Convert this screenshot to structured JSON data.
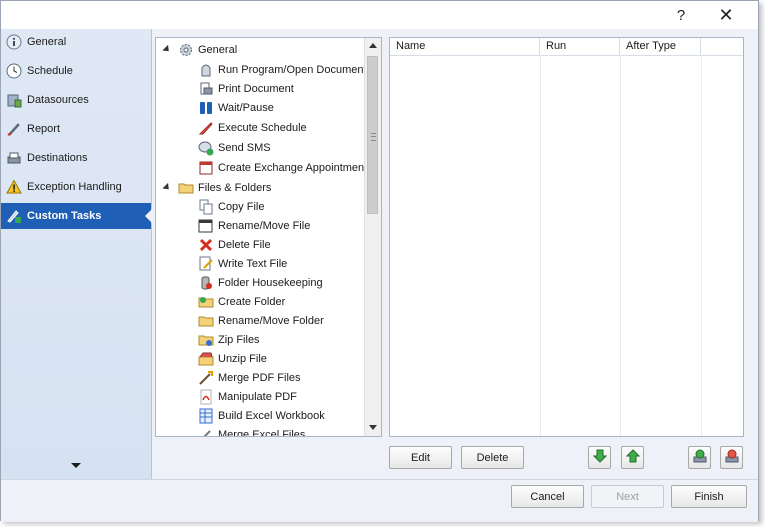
{
  "titlebar": {
    "help": "?",
    "close": "✕"
  },
  "sidebar": {
    "items": [
      {
        "label": "General",
        "icon": "info-icon"
      },
      {
        "label": "Schedule",
        "icon": "clock-icon"
      },
      {
        "label": "Datasources",
        "icon": "database-icon"
      },
      {
        "label": "Report",
        "icon": "rocket-icon"
      },
      {
        "label": "Destinations",
        "icon": "printer-icon"
      },
      {
        "label": "Exception Handling",
        "icon": "warning-icon"
      },
      {
        "label": "Custom Tasks",
        "icon": "tasks-icon",
        "active": true
      }
    ]
  },
  "tree": {
    "groups": [
      {
        "label": "General",
        "items": [
          "Run Program/Open Document",
          "Print Document",
          "Wait/Pause",
          "Execute Schedule",
          "Send SMS",
          "Create Exchange Appointment"
        ]
      },
      {
        "label": "Files & Folders",
        "items": [
          "Copy File",
          "Rename/Move File",
          "Delete File",
          "Write Text File",
          "Folder Housekeeping",
          "Create Folder",
          "Rename/Move Folder",
          "Zip Files",
          "Unzip File",
          "Merge PDF Files",
          "Manipulate PDF",
          "Build Excel Workbook",
          "Merge Excel Files"
        ]
      }
    ]
  },
  "grid": {
    "columns": [
      "Name",
      "Run",
      "After Type",
      ""
    ]
  },
  "actions": {
    "edit": "Edit",
    "delete": "Delete"
  },
  "footer": {
    "cancel": "Cancel",
    "next": "Next",
    "finish": "Finish"
  },
  "colors": {
    "active_nav": "#1f5fb6",
    "sidebar_bg": "#dfe8f5"
  }
}
